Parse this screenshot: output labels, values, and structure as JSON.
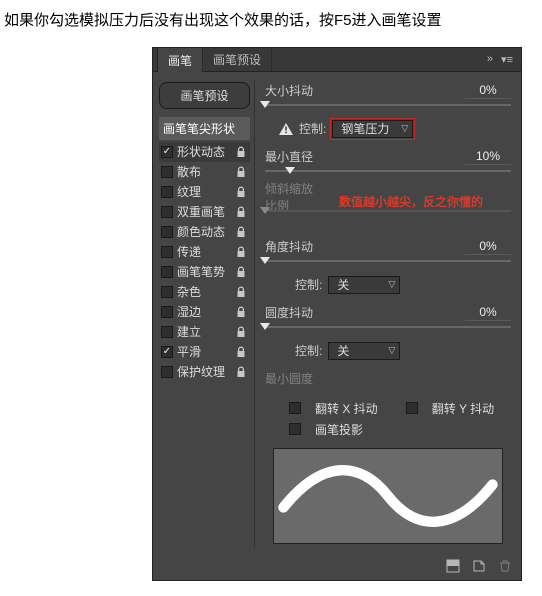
{
  "caption": "如果你勾选模拟压力后没有出现这个效果的话，按F5进入画笔设置",
  "tabs": {
    "brush": "画笔",
    "preset": "画笔预设"
  },
  "left": {
    "presetBtn": "画笔预设",
    "catHeader": "画笔笔尖形状",
    "items": [
      {
        "label": "形状动态",
        "checked": true,
        "dim": false
      },
      {
        "label": "散布",
        "checked": false,
        "dim": false
      },
      {
        "label": "纹理",
        "checked": false,
        "dim": false
      },
      {
        "label": "双重画笔",
        "checked": false,
        "dim": false
      },
      {
        "label": "颜色动态",
        "checked": false,
        "dim": false
      },
      {
        "label": "传递",
        "checked": false,
        "dim": false
      },
      {
        "label": "画笔笔势",
        "checked": false,
        "dim": false
      },
      {
        "label": "杂色",
        "checked": false,
        "dim": false
      },
      {
        "label": "湿边",
        "checked": false,
        "dim": false
      },
      {
        "label": "建立",
        "checked": false,
        "dim": false
      },
      {
        "label": "平滑",
        "checked": true,
        "dim": false
      },
      {
        "label": "保护纹理",
        "checked": false,
        "dim": false
      }
    ]
  },
  "right": {
    "sizeJitter": {
      "label": "大小抖动",
      "value": "0%",
      "pos": 0
    },
    "control1": {
      "label": "控制:",
      "value": "钢笔压力"
    },
    "minDiameter": {
      "label": "最小直径",
      "value": "10%",
      "pos": 10
    },
    "annotation": "数值越小越尖，反之你懂的",
    "tiltScale": {
      "label": "倾斜缩放比例",
      "disabledPos": 0
    },
    "angleJitter": {
      "label": "角度抖动",
      "value": "0%",
      "pos": 0
    },
    "control2": {
      "label": "控制:",
      "value": "关"
    },
    "roundJitter": {
      "label": "圆度抖动",
      "value": "0%",
      "pos": 0
    },
    "control3": {
      "label": "控制:",
      "value": "关"
    },
    "minRound": {
      "label": "最小圆度"
    },
    "flipX": "翻转 X 抖动",
    "flipY": "翻转 Y 抖动",
    "brushProj": "画笔投影"
  }
}
